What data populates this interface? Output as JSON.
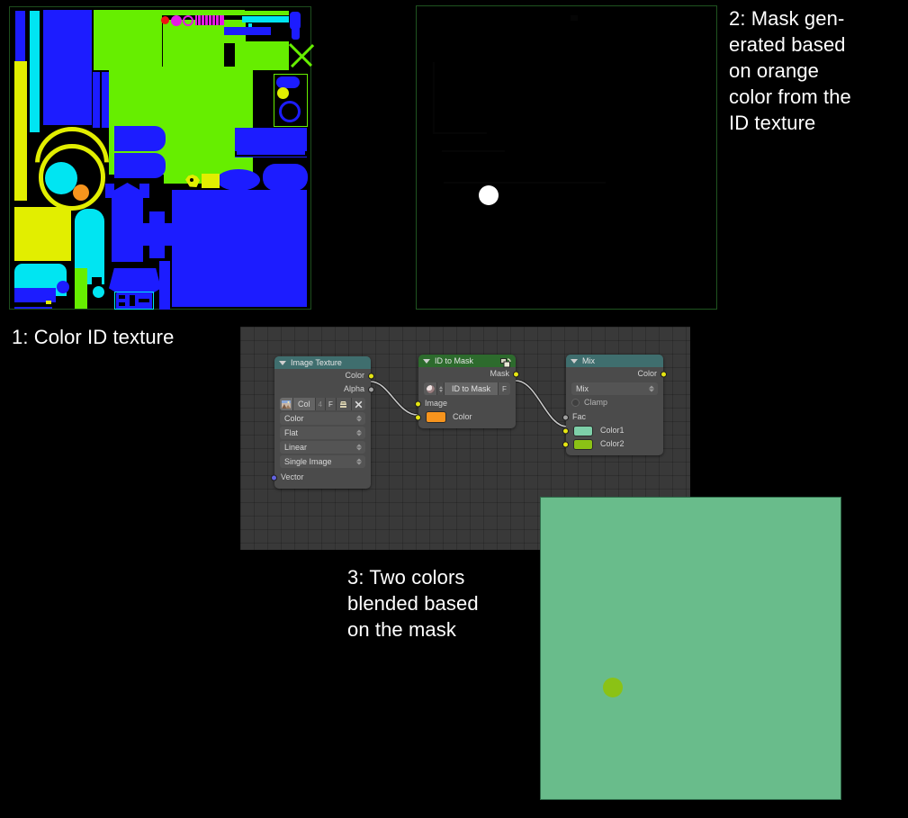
{
  "captions": {
    "one": "1: Color ID texture",
    "two": "2: Mask gen-\nerated based\non orange\ncolor from the\nID texture",
    "three": "3: Two colors\nblended based\non the mask"
  },
  "colors": {
    "background": "#000000",
    "caption_text": "#ffffff",
    "node_editor_bg": "#393939",
    "node_body": "#4b4b4b",
    "header_teal": "#3f6e6e",
    "header_green": "#2d6b2d",
    "socket_yellow": "#e5e512",
    "socket_gray": "#a1a1a1",
    "socket_purple": "#6363e0",
    "id_orange": "#f7941d",
    "mask_white": "#ffffff",
    "result_bg": "#69bc8b",
    "result_dot": "#8bc215",
    "mix_color1": "#7ecfa8",
    "mix_color2": "#8bc215",
    "id_blue": "#1c1cff",
    "id_green": "#66ee00",
    "id_cyan": "#00e5f2",
    "id_yellow": "#e2ee00",
    "id_magenta": "#e519e5",
    "id_red": "#f01414"
  },
  "node_editor": {
    "nodes": [
      {
        "name": "image-texture-node",
        "title": "Image Texture",
        "header_color": "#3f6e6e",
        "outputs": [
          {
            "label": "Color",
            "socket": "yellow"
          },
          {
            "label": "Alpha",
            "socket": "gray"
          }
        ],
        "datablock": {
          "image_icon": "image-icon",
          "name": "Col",
          "users": "4",
          "fake_user": "F",
          "pack_icon": "pack-icon",
          "close_icon": "X"
        },
        "dropdowns": [
          "Color",
          "Flat",
          "Linear",
          "Single Image"
        ],
        "inputs": [
          {
            "label": "Vector",
            "socket": "purple"
          }
        ]
      },
      {
        "name": "id-to-mask-node",
        "title": "ID to Mask",
        "header_color": "#2d6b2d",
        "header_icon": "node-group-icon",
        "outputs": [
          {
            "label": "Mask",
            "socket": "yellow"
          }
        ],
        "id_widget": {
          "browse_icon": "material-sphere-icon",
          "value": "ID to Mask",
          "fake_user": "F"
        },
        "inputs": [
          {
            "label": "Image",
            "socket": "yellow"
          },
          {
            "label": "Color",
            "socket": "yellow",
            "swatch": "#f7941d"
          }
        ]
      },
      {
        "name": "mix-node",
        "title": "Mix",
        "header_color": "#3f6e6e",
        "outputs": [
          {
            "label": "Color",
            "socket": "yellow"
          }
        ],
        "blend_mode": "Mix",
        "clamp": {
          "label": "Clamp",
          "checked": false
        },
        "inputs": [
          {
            "label": "Fac",
            "socket": "gray"
          },
          {
            "label": "Color1",
            "socket": "yellow",
            "swatch": "#7ecfa8"
          },
          {
            "label": "Color2",
            "socket": "yellow",
            "swatch": "#8bc215"
          }
        ]
      }
    ],
    "links": [
      {
        "from": "Image Texture.Color",
        "to": "ID to Mask.Image"
      },
      {
        "from": "ID to Mask.Mask",
        "to": "Mix.Fac"
      }
    ]
  },
  "panels": {
    "id_texture": {
      "name": "color-id-texture-image"
    },
    "mask": {
      "name": "mask-result-image"
    },
    "result": {
      "name": "blended-result-image"
    }
  }
}
